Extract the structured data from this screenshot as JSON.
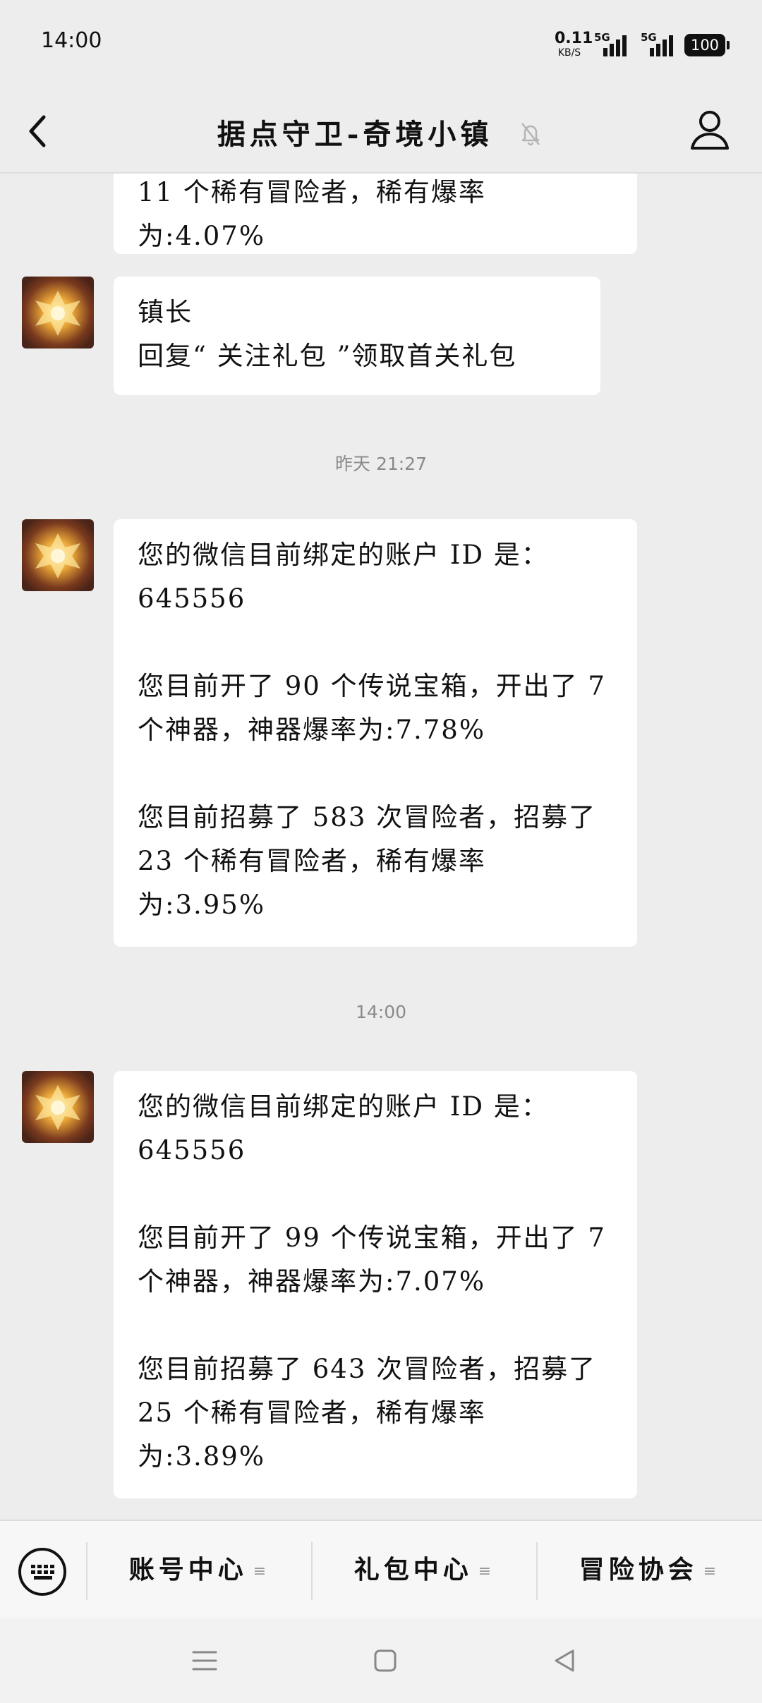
{
  "status_bar": {
    "time": "14:00",
    "net_speed": "0.11",
    "net_unit": "KB/S",
    "sim1": "5G",
    "sim2": "5G",
    "battery": "100"
  },
  "header": {
    "title": "据点守卫-奇境小镇",
    "icons": [
      "back-arrow-icon",
      "mute-bell-icon",
      "profile-icon"
    ]
  },
  "messages": {
    "partial_top": "11 个稀有冒险者，稀有爆率为:4.07%",
    "m1": {
      "line1": "镇长",
      "line2": "回复“ 关注礼包 ”领取首关礼包"
    },
    "ts1": "昨天 21:27",
    "m2": {
      "p1": "您的微信目前绑定的账户 ID 是：",
      "p1b": "645556",
      "p2a": "您目前开了 90 个传说宝箱，开出了 7",
      "p2b": "个神器，神器爆率为:7.78%",
      "p3a": "您目前招募了 583 次冒险者，招募了",
      "p3b": "23 个稀有冒险者，稀有爆率为:3.95%"
    },
    "ts2": "14:00",
    "m3": {
      "p1": "您的微信目前绑定的账户 ID 是：",
      "p1b": "645556",
      "p2a": "您目前开了 99 个传说宝箱，开出了 7",
      "p2b": "个神器，神器爆率为:7.07%",
      "p3a": "您目前招募了 643 次冒险者，招募了",
      "p3b": "25 个稀有冒险者，稀有爆率为:3.89%"
    }
  },
  "bottom_menu": {
    "items": [
      {
        "label": "账号中心"
      },
      {
        "label": "礼包中心"
      },
      {
        "label": "冒险协会"
      }
    ]
  },
  "colors": {
    "background": "#ededed",
    "bubble": "#ffffff",
    "timestamp": "#8a8a8a"
  }
}
